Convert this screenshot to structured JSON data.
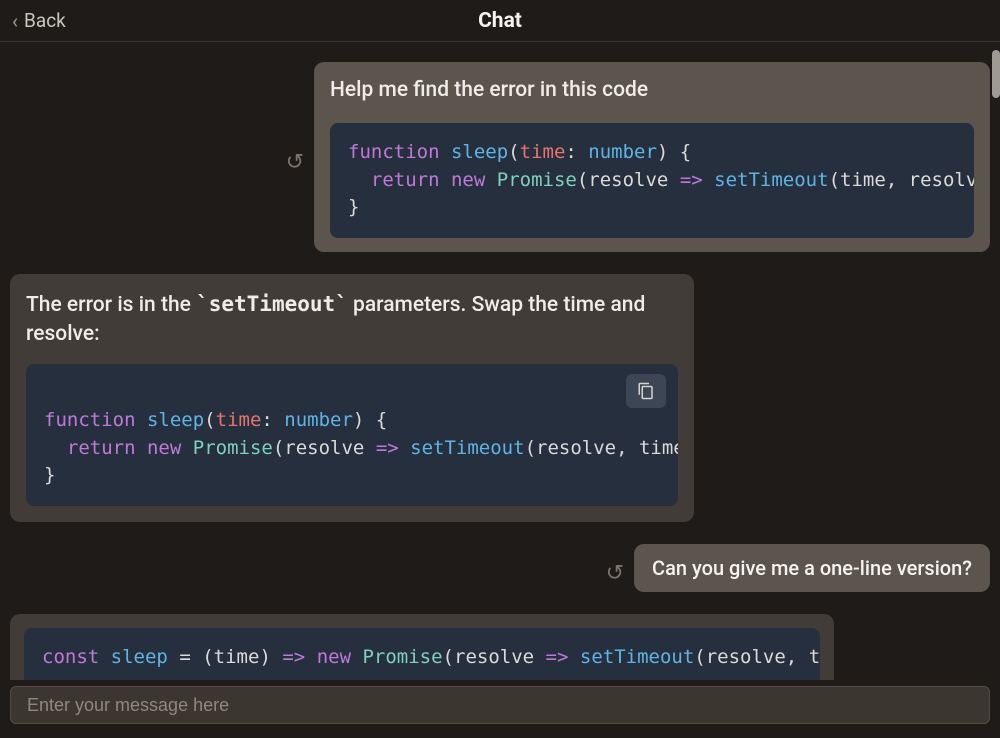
{
  "header": {
    "back_label": "Back",
    "title": "Chat"
  },
  "input": {
    "placeholder": "Enter your message here"
  },
  "messages": {
    "m1": {
      "text": "Help me find the error in this code"
    },
    "m2": {
      "text_prefix": "The error is in the ",
      "text_code": "`setTimeout`",
      "text_suffix": " parameters. Swap the time and resolve:"
    },
    "m3": {
      "text": "Can you give me a one-line version?"
    }
  },
  "code": {
    "c1": {
      "tokens": {
        "function": "function",
        "sleep": "sleep",
        "time": "time",
        "number": "number",
        "return": "return",
        "new": "new",
        "Promise": "Promise",
        "resolve": "resolve",
        "arrow": "=>",
        "setTimeout": "setTimeout"
      }
    },
    "c2": {
      "tokens": {
        "function": "function",
        "sleep": "sleep",
        "time": "time",
        "number": "number",
        "return": "return",
        "new": "new",
        "Promise": "Promise",
        "resolve": "resolve",
        "arrow": "=>",
        "setTimeout": "setTimeout"
      }
    },
    "c3": {
      "tokens": {
        "const": "const",
        "sleep": "sleep",
        "eq": "=",
        "time": "time",
        "arrow": "=>",
        "new": "new",
        "Promise": "Promise",
        "resolve": "resolve",
        "setTimeout": "setTimeout"
      }
    }
  },
  "icons": {
    "regenerate": "↺"
  }
}
